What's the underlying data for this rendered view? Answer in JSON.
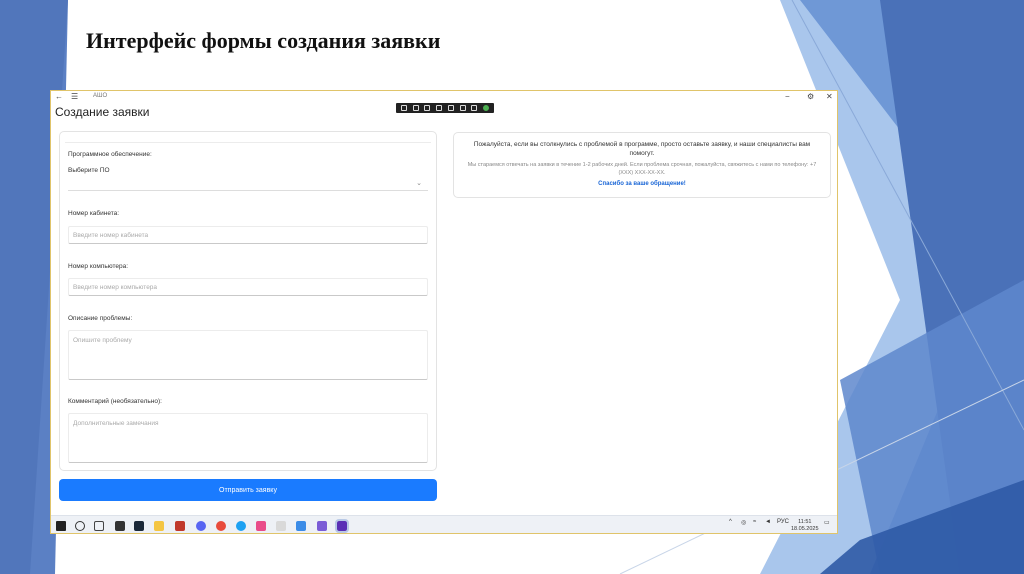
{
  "slide": {
    "title": "Интерфейс формы создания заявки"
  },
  "window": {
    "app_name": "АШО",
    "back_glyph": "←",
    "menu_glyph": "☰",
    "minimize_glyph": "−",
    "maximize_glyph": "⚙",
    "close_glyph": "✕"
  },
  "page": {
    "heading": "Создание заявки"
  },
  "form": {
    "software_section_label": "Программное обеспечение:",
    "software_select_label": "Выберите ПО",
    "software_select_value": "",
    "office_label": "Номер кабинета:",
    "office_placeholder": "Введите номер кабинета",
    "computer_label": "Номер компьютера:",
    "computer_placeholder": "Введите номер компьютера",
    "problem_label": "Описание проблемы:",
    "problem_placeholder": "Опишите проблему",
    "comment_label": "Комментарий (необязательно):",
    "comment_placeholder": "Дополнительные замечания",
    "submit_label": "Отправить заявку"
  },
  "info": {
    "text1": "Пожалуйста, если вы столкнулись с проблемой в программе, просто оставьте заявку, и наши специалисты вам помогут.",
    "text2": "Мы стараемся отвечать на заявки в течение 1-2 рабочих дней. Если проблема срочная, пожалуйста, свяжитесь с нами по телефону: +7 (XXX) XXX-XX-XX.",
    "thanks": "Спасибо за ваше обращение!"
  },
  "taskbar": {
    "language": "РУС",
    "time": "11:51",
    "date": "18.05.2025"
  },
  "colors": {
    "accent": "#1a7bff",
    "link": "#1a66d6",
    "deco_blue": "#5b8fd0",
    "deco_dark": "#3c6ab4"
  }
}
